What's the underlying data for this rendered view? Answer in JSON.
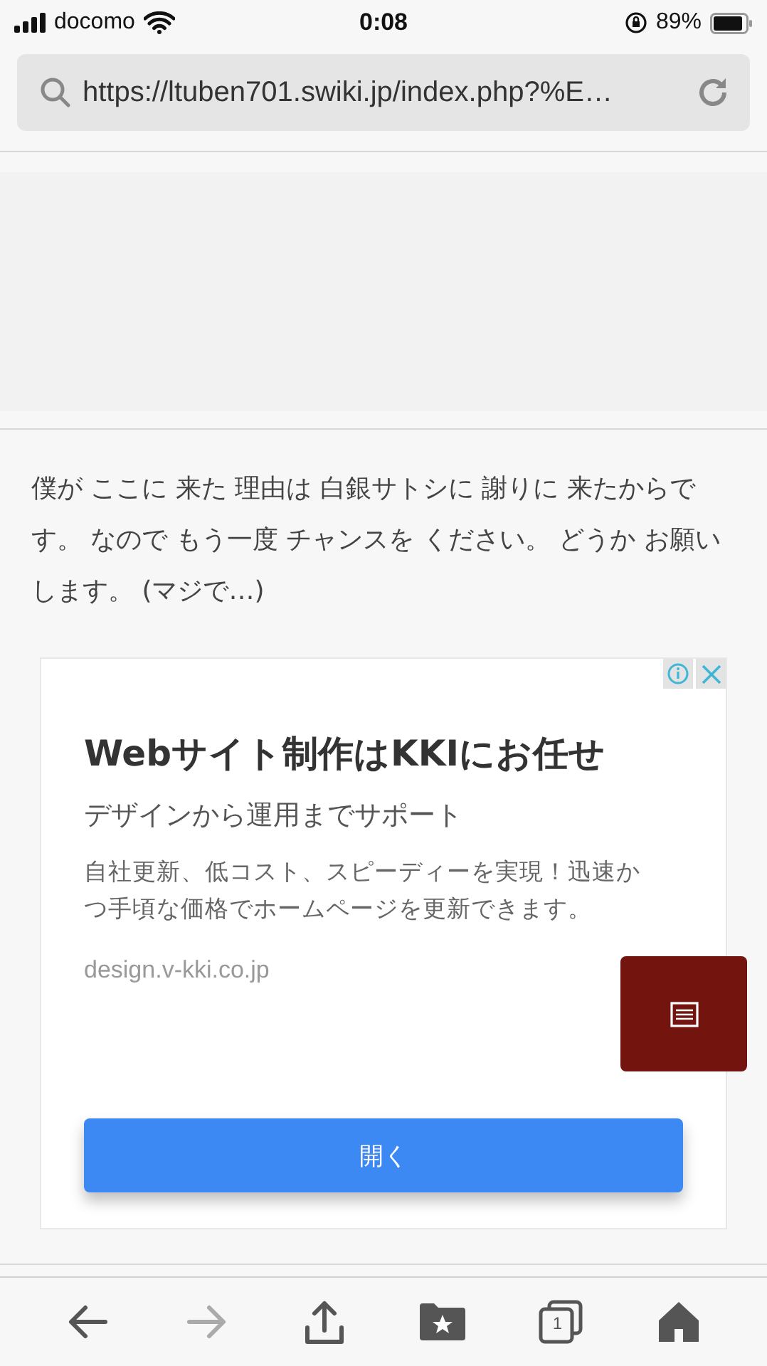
{
  "status_bar": {
    "carrier": "docomo",
    "time": "0:08",
    "battery": "89%"
  },
  "address_bar": {
    "url": "https://ltuben701.swiki.jp/index.php?%E…"
  },
  "article": {
    "text": "僕が ここに 来た 理由は 白銀サトシに 謝りに 来たからです。 なので もう一度 チャンスを ください。 どうか お願いします。 (マジで…)"
  },
  "ad": {
    "title": "Webサイト制作はKKIにお任せ",
    "subtitle": "デザインから運用までサポート",
    "description": "自社更新、低コスト、スピーディーを実現！迅速かつ手頃な価格でホームページを更新できます。",
    "domain": "design.v-kki.co.jp",
    "button": "開く"
  },
  "toolbar": [
    {
      "kind": "back",
      "disabled": false
    },
    {
      "kind": "forward",
      "disabled": true
    },
    {
      "kind": "share",
      "disabled": false
    },
    {
      "kind": "bookmarks",
      "disabled": false
    },
    {
      "kind": "tabs",
      "disabled": false,
      "count": "1"
    },
    {
      "kind": "home",
      "disabled": false
    }
  ]
}
